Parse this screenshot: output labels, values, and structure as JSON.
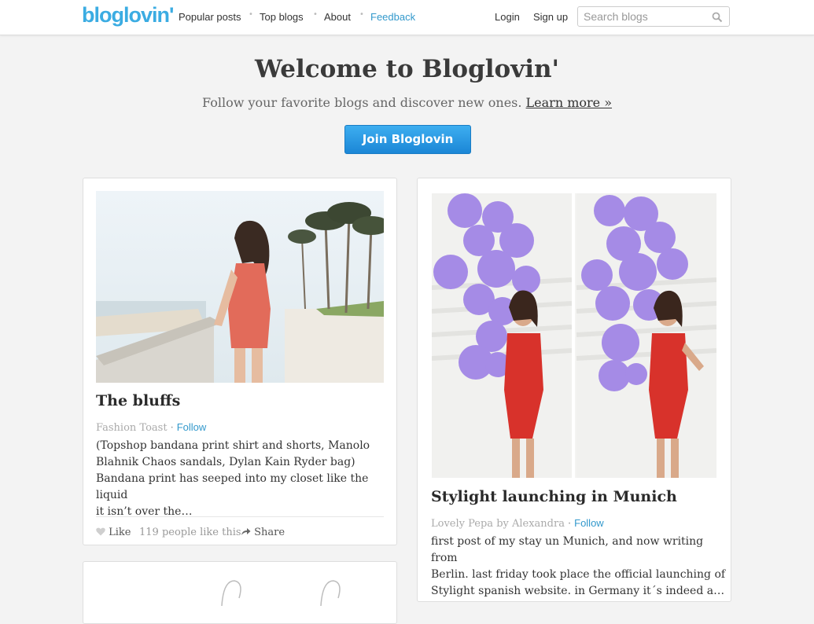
{
  "header": {
    "logo": "bloglovin'",
    "nav": [
      "Popular posts",
      "Top blogs",
      "About",
      "Feedback"
    ],
    "login": "Login",
    "signup": "Sign up",
    "search_placeholder": "Search blogs"
  },
  "hero": {
    "title": "Welcome to Bloglovin'",
    "subtitle": "Follow your favorite blogs and discover new ones.",
    "learn_more": "Learn more »",
    "join_button": "Join Bloglovin"
  },
  "posts": [
    {
      "title": "The bluffs",
      "blog": "Fashion Toast",
      "sep": "·",
      "follow": "Follow",
      "excerpt": [
        "(Topshop bandana print shirt and shorts, Manolo",
        "Blahnik Chaos sandals, Dylan Kain Ryder bag)",
        "Bandana print has seeped into my closet like the liquid",
        "it isn’t over the…"
      ],
      "like": "Like",
      "likes_count": "119 people like this",
      "share": "Share"
    },
    {
      "title": "Stylight launching in Munich",
      "blog": "Lovely Pepa by Alexandra",
      "sep": "·",
      "follow": "Follow",
      "excerpt": [
        "first post of my stay un Munich, and now writing from",
        "Berlin. last friday took place the official launching of",
        "Stylight spanish website. in Germany it´s indeed a…"
      ]
    }
  ],
  "colors": {
    "brand": "#3bace2",
    "link": "#3399cc",
    "button": "#2a98e3"
  }
}
